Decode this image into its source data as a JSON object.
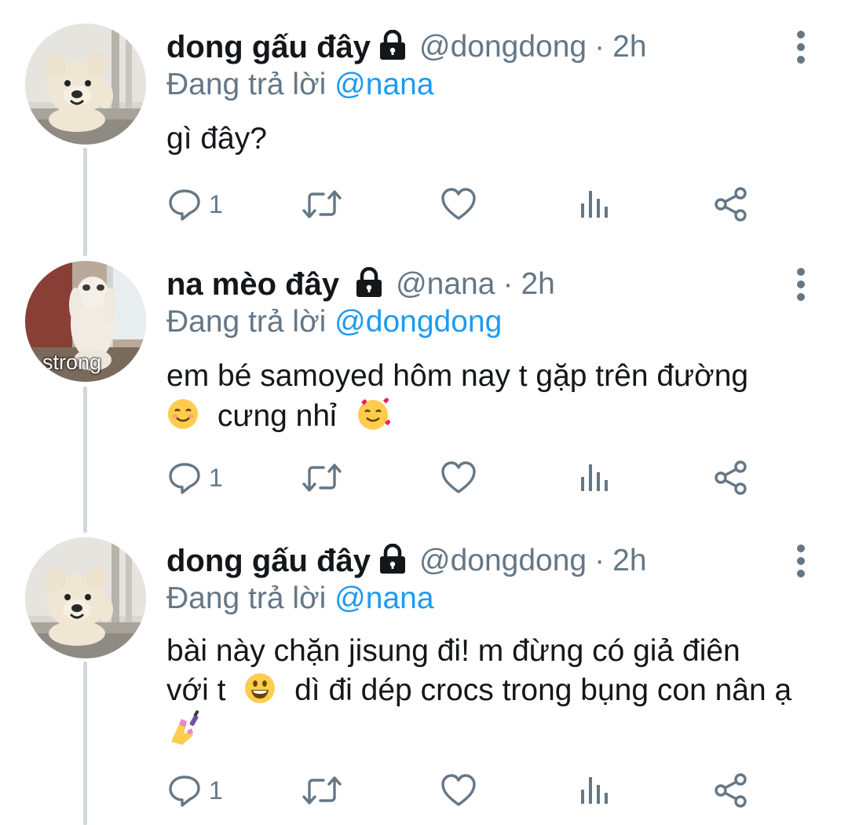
{
  "tweets": [
    {
      "display_name": "dong gấu đây",
      "handle": "@dongdong",
      "separator": "·",
      "time": "2h",
      "reply_prefix": "Đang trả lời",
      "reply_handle": "@nana",
      "text_lines": [
        "gì đây?"
      ],
      "reply_count": "1",
      "avatar": "teddy-bear-window"
    },
    {
      "display_name": "na mèo đây",
      "handle": "@nana",
      "separator": "·",
      "time": "2h",
      "reply_prefix": "Đang trả lời",
      "reply_handle": "@dongdong",
      "text_lines": [
        "em bé samoyed hôm nay t gặp trên đường"
      ],
      "text_line2_emoji1": "☺",
      "text_line2_text": "cưng nhỉ",
      "text_line2_emoji2": "♥",
      "reply_count": "1",
      "avatar": "cat-standing",
      "avatar_caption": "strong"
    },
    {
      "display_name": "dong gấu đây",
      "handle": "@dongdong",
      "separator": "·",
      "time": "2h",
      "reply_prefix": "Đang trả lời",
      "reply_handle": "@nana",
      "text_line1": "bài này chặn jisung đi! m đừng có giả điên",
      "text_line2_a": "với t",
      "text_line2_emoji": "☻",
      "text_line2_b": "dì đi dép crocs trong bụng con nân ạ",
      "text_line3_emoji": "💅",
      "reply_count": "1",
      "avatar": "teddy-bear-window"
    }
  ],
  "icons": {
    "reply": "reply-icon",
    "retweet": "retweet-icon",
    "like": "heart-icon",
    "views": "analytics-icon",
    "share": "share-icon",
    "more": "more-vertical-icon",
    "lock": "lock-icon"
  },
  "colors": {
    "name": "#14171a",
    "secondary": "#657786",
    "mention": "#1d9bf0",
    "thread_line": "#cfd9de"
  }
}
